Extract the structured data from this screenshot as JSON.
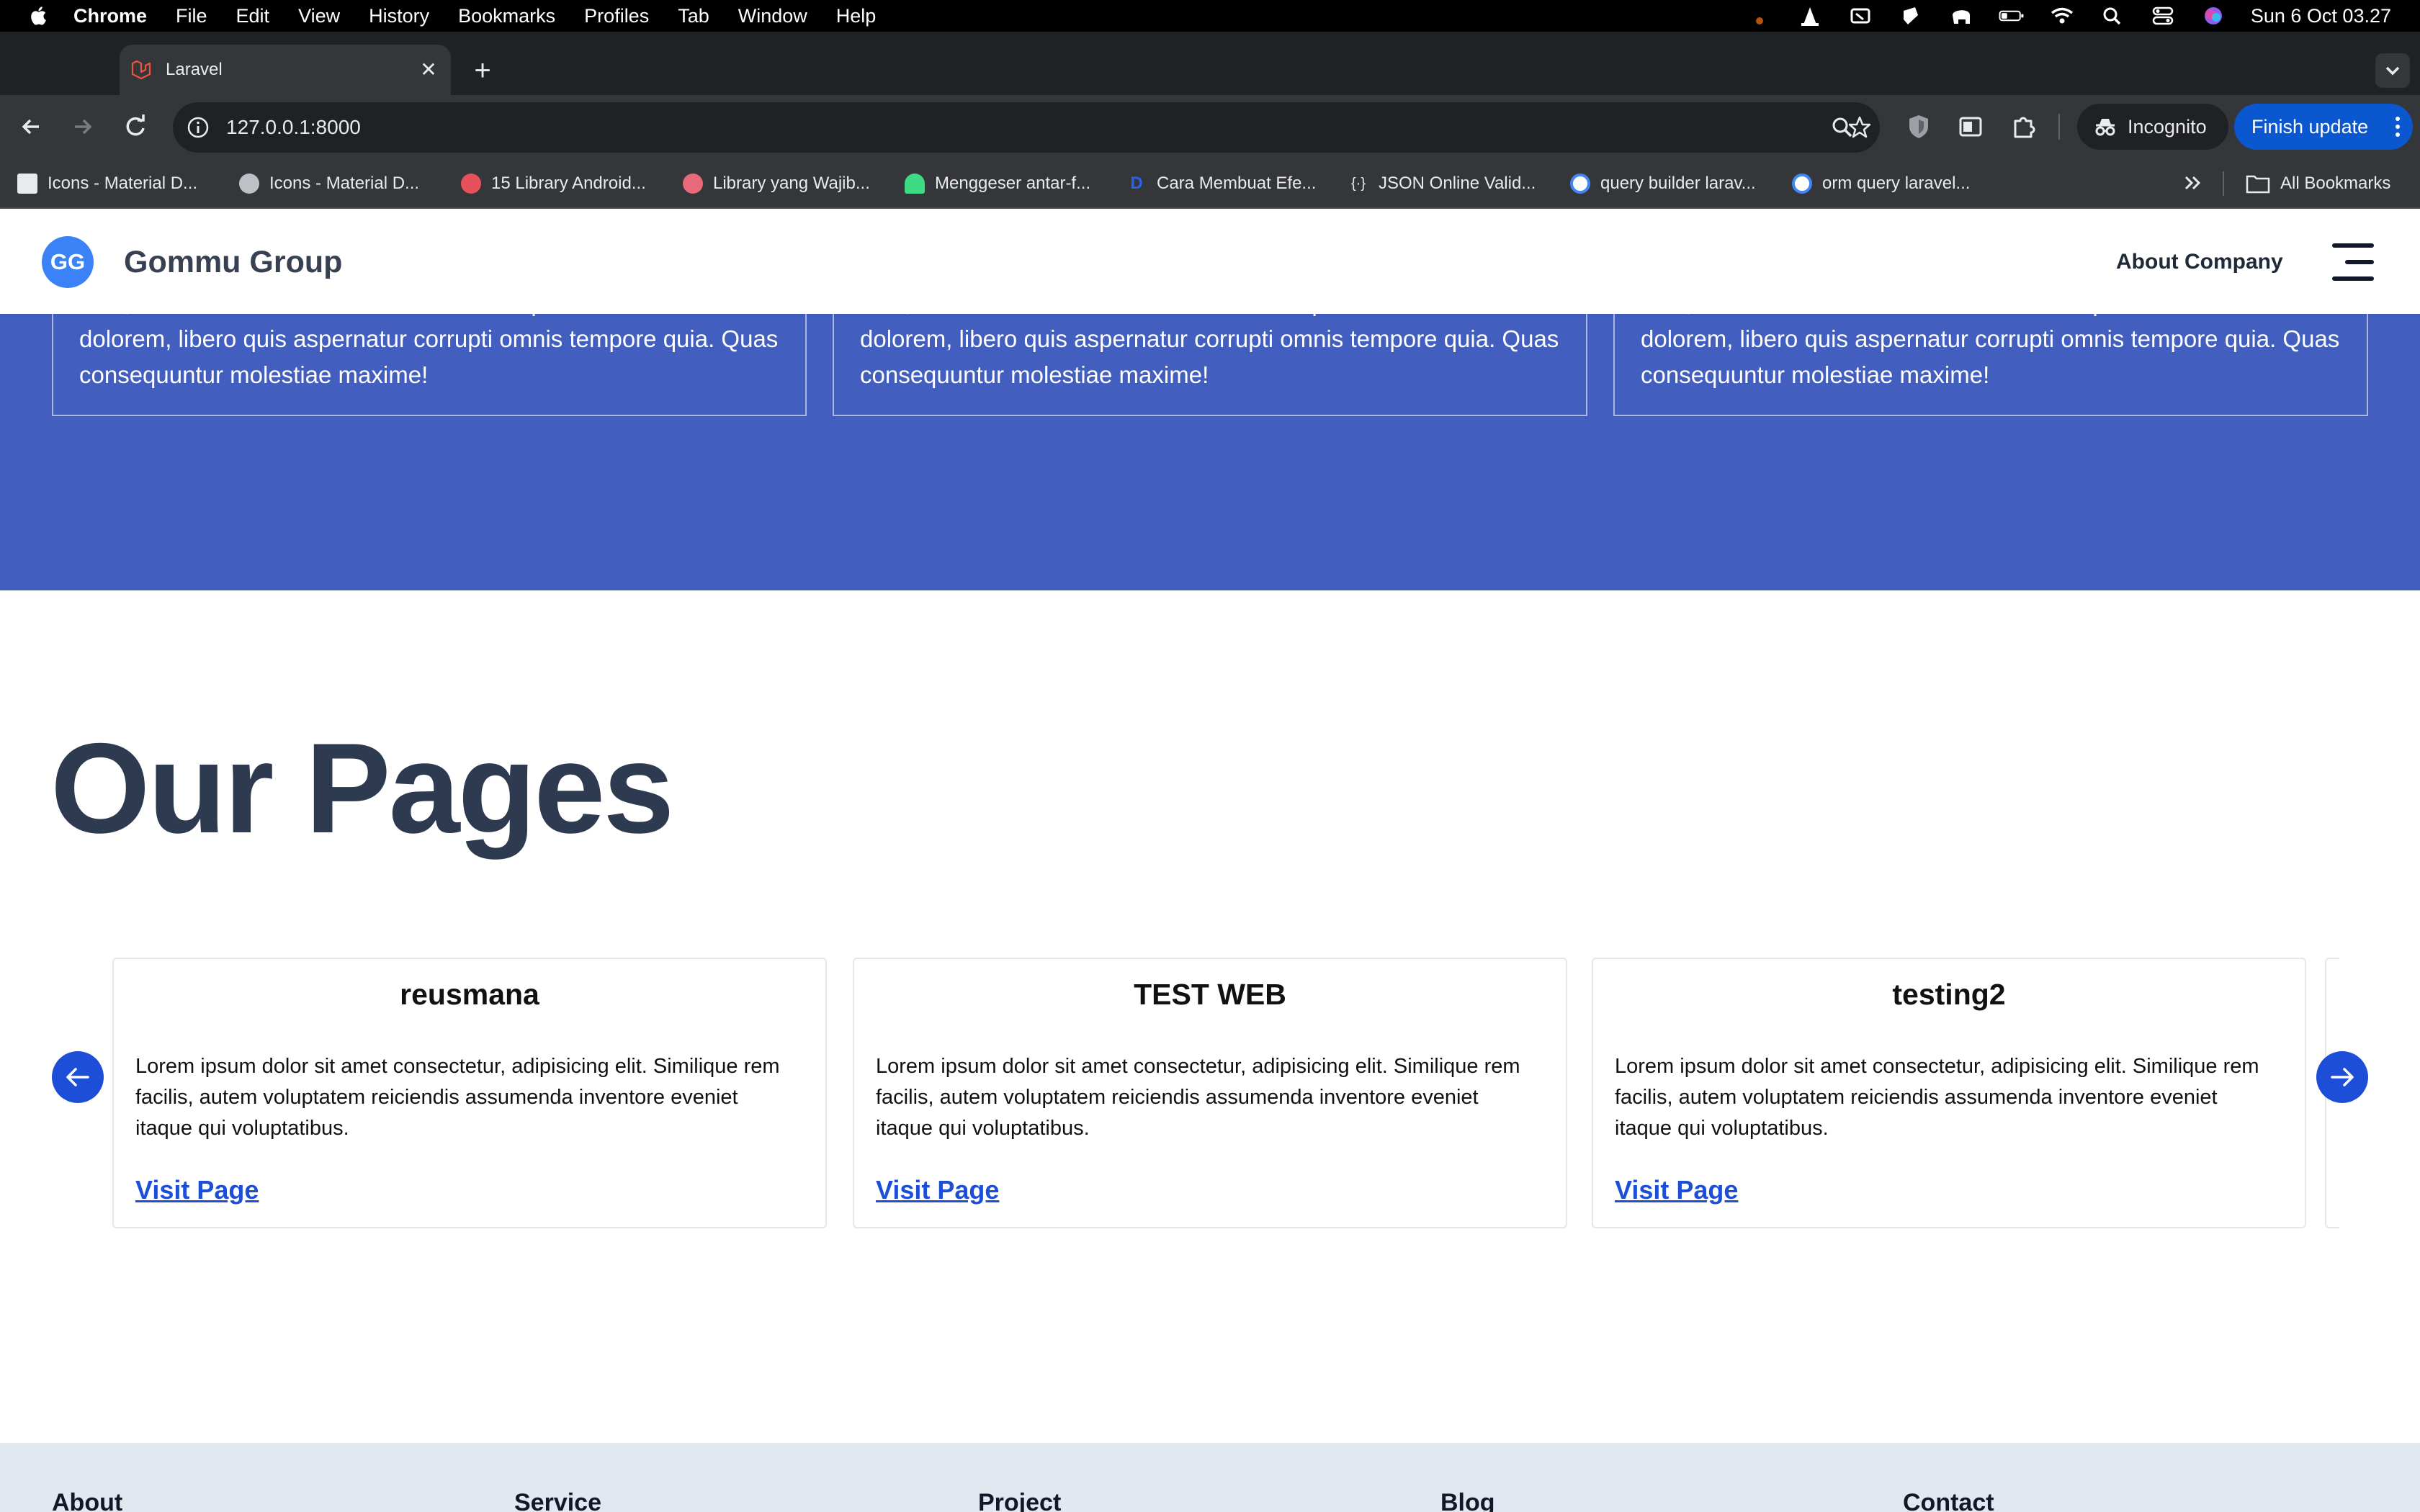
{
  "menubar": {
    "app": "Chrome",
    "items": [
      "File",
      "Edit",
      "View",
      "History",
      "Bookmarks",
      "Profiles",
      "Tab",
      "Window",
      "Help"
    ],
    "clock": "Sun 6 Oct  03.27"
  },
  "tabs": [
    {
      "title": "Laravel"
    }
  ],
  "toolbar": {
    "url": "127.0.0.1:8000",
    "incognito_label": "Incognito",
    "update_label": "Finish update"
  },
  "bookmarks": {
    "items": [
      {
        "label": "Icons - Material D...",
        "icon": "doc-icon",
        "color": "#ffffff"
      },
      {
        "label": "Icons - Material D...",
        "icon": "globe-icon",
        "color": "#bdc1c6"
      },
      {
        "label": "15 Library Android...",
        "icon": "site-icon",
        "color": "#e8505b"
      },
      {
        "label": "Library yang Wajib...",
        "icon": "site-icon",
        "color": "#e86a7a"
      },
      {
        "label": "Menggeser antar-f...",
        "icon": "android-icon",
        "color": "#3ddc84"
      },
      {
        "label": "Cara Membuat Efe...",
        "icon": "d-icon",
        "color": "#2563eb"
      },
      {
        "label": "JSON Online Valid...",
        "icon": "json-icon",
        "color": "#e8eaed"
      },
      {
        "label": "query builder larav...",
        "icon": "google-icon",
        "color": "#4285f4"
      },
      {
        "label": "orm query laravel...",
        "icon": "google-icon",
        "color": "#4285f4"
      }
    ],
    "all_label": "All Bookmarks"
  },
  "site": {
    "logo_initials": "GG",
    "brand": "Gommu Group",
    "nav_about": "About Company",
    "testimonials": [
      {
        "text": "temporibus! Consectetur asperiores sunt at. Deserunt odit dolores sunt, laboriosam dolor necessitatibus iure quidem est id velit dolorem, libero quis aspernatur corrupti omnis tempore quia. Quas consequuntur molestiae maxime!"
      },
      {
        "text": "temporibus! Consectetur asperiores sunt at. Deserunt odit dolores sunt, laboriosam dolor necessitatibus iure quidem est id velit dolorem, libero quis aspernatur corrupti omnis tempore quia. Quas consequuntur molestiae maxime!"
      },
      {
        "text": "temporibus! Consectetur asperiores sunt at. Deserunt odit dolores sunt, laboriosam dolor necessitatibus iure quidem est id velit dolorem, libero quis aspernatur corrupti omnis tempore quia. Quas consequuntur molestiae maxime!"
      }
    ],
    "section_title": "Our Pages",
    "pages": [
      {
        "title": "reusmana",
        "desc": "Lorem ipsum dolor sit amet consectetur, adipisicing elit. Similique rem facilis, autem voluptatem reiciendis assumenda inventore eveniet itaque qui voluptatibus.",
        "link": "Visit Page"
      },
      {
        "title": "TEST WEB",
        "desc": "Lorem ipsum dolor sit amet consectetur, adipisicing elit. Similique rem facilis, autem voluptatem reiciendis assumenda inventore eveniet itaque qui voluptatibus.",
        "link": "Visit Page"
      },
      {
        "title": "testing2",
        "desc": "Lorem ipsum dolor sit amet consectetur, adipisicing elit. Similique rem facilis, autem voluptatem reiciendis assumenda inventore eveniet itaque qui voluptatibus.",
        "link": "Visit Page"
      }
    ],
    "footer_columns": [
      "About",
      "Service",
      "Project",
      "Blog",
      "Contact"
    ]
  },
  "colors": {
    "accent_blue": "#1d4ed8",
    "band_blue": "#425fbf",
    "logo_blue": "#3b82f6",
    "footer_bg": "#e2e8f0"
  }
}
